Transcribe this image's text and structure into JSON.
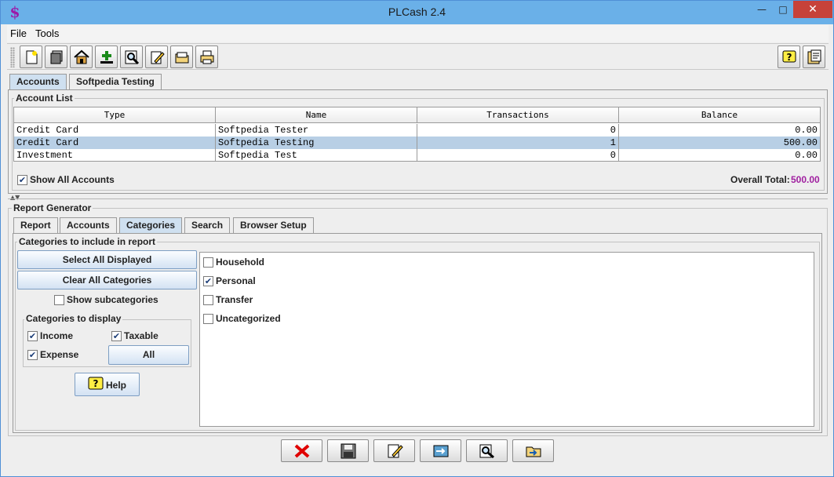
{
  "window": {
    "title": "PLCash 2.4",
    "app_icon": "dollar-sign-icon",
    "minimize": "—",
    "maximize": "□",
    "close": "✕"
  },
  "menu": [
    "File",
    "Tools"
  ],
  "toolbar": {
    "buttons": [
      "new-file-icon",
      "accounts-stack-icon",
      "home-icon",
      "add-icon",
      "search-icon",
      "edit-icon",
      "folder-icon",
      "print-icon"
    ],
    "right_buttons": [
      "help-icon",
      "report-icon"
    ]
  },
  "top_tabs": [
    "Accounts",
    "Softpedia Testing"
  ],
  "account_list": {
    "title": "Account List",
    "columns": [
      "Type",
      "Name",
      "Transactions",
      "Balance"
    ],
    "rows": [
      {
        "type": "Credit Card",
        "name": "Softpedia Tester",
        "transactions": "0",
        "balance": "0.00"
      },
      {
        "type": "Credit Card",
        "name": "Softpedia Testing",
        "transactions": "1",
        "balance": "500.00"
      },
      {
        "type": "Investment",
        "name": "Softpedia Test",
        "transactions": "0",
        "balance": "0.00"
      }
    ],
    "show_all_label": "Show All Accounts",
    "show_all_checked": true,
    "overall_label": "Overall Total:",
    "overall_value": "500.00"
  },
  "report": {
    "title": "Report Generator",
    "tabs": [
      "Report",
      "Accounts",
      "Categories",
      "Search",
      "Browser Setup"
    ],
    "active_tab": "Categories",
    "categories_group": "Categories to include in report",
    "select_all": "Select All Displayed",
    "clear_all": "Clear All Categories",
    "show_sub": "Show subcategories",
    "display_group": "Categories to display",
    "income": "Income",
    "taxable": "Taxable",
    "expense": "Expense",
    "all": "All",
    "help": "Help",
    "categories": [
      {
        "label": "Household",
        "checked": false
      },
      {
        "label": "Personal",
        "checked": true
      },
      {
        "label": "Transfer",
        "checked": false
      },
      {
        "label": "Uncategorized",
        "checked": false
      }
    ]
  },
  "bottom_buttons": [
    "cancel-icon",
    "save-icon",
    "edit-icon",
    "export-icon",
    "preview-icon",
    "open-icon"
  ],
  "colors": {
    "accent_total": "#a020a0",
    "close_button": "#c7423a",
    "titlebar": "#6ab0e8"
  }
}
